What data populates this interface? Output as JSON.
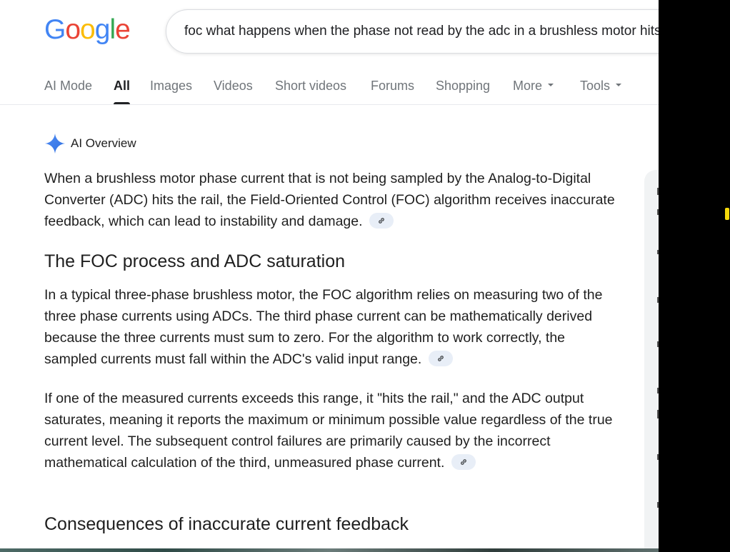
{
  "logo": {
    "text": "Google",
    "letters": [
      {
        "ch": "G",
        "color": "#4285F4"
      },
      {
        "ch": "o",
        "color": "#EA4335"
      },
      {
        "ch": "o",
        "color": "#FBBC05"
      },
      {
        "ch": "g",
        "color": "#4285F4"
      },
      {
        "ch": "l",
        "color": "#34A853"
      },
      {
        "ch": "e",
        "color": "#EA4335"
      }
    ]
  },
  "search": {
    "value": "foc what happens when the phase not read by the adc in a brushless motor hits the rail"
  },
  "tabs": [
    {
      "label": "AI Mode",
      "active": false,
      "dropdown": false
    },
    {
      "label": "All",
      "active": true,
      "dropdown": false
    },
    {
      "label": "Images",
      "active": false,
      "dropdown": false
    },
    {
      "label": "Videos",
      "active": false,
      "dropdown": false
    },
    {
      "label": "Short videos",
      "active": false,
      "dropdown": false
    },
    {
      "label": "Forums",
      "active": false,
      "dropdown": false
    },
    {
      "label": "Shopping",
      "active": false,
      "dropdown": false
    },
    {
      "label": "More",
      "active": false,
      "dropdown": true
    },
    {
      "label": "Tools",
      "active": false,
      "dropdown": true
    }
  ],
  "ai_overview": {
    "title": "AI Overview",
    "icon": "sparkle-icon",
    "intro": "When a brushless motor phase current that is not being sampled by the Analog-to-Digital Converter (ADC) hits the rail, the Field-Oriented Control (FOC) algorithm receives inaccurate feedback, which can lead to instability and damage.",
    "section1_heading": "The FOC process and ADC saturation",
    "section1_p1": "In a typical three-phase brushless motor, the FOC algorithm relies on measuring two of the three phase currents using ADCs. The third phase current can be mathematically derived because the three currents must sum to zero. For the algorithm to work correctly, the sampled currents must fall within the ADC's valid input range.",
    "section1_p2": "If one of the measured currents exceeds this range, it \"hits the rail,\" and the ADC output saturates, meaning it reports the maximum or minimum possible value regardless of the true current level. The subsequent control failures are primarily caused by the incorrect mathematical calculation of the third, unmeasured phase current.",
    "section2_heading": "Consequences of inaccurate current feedback"
  },
  "colors": {
    "accent_blue": "#4285F4",
    "text": "#1f1f1f",
    "muted": "#70757a",
    "chip_bg": "#e8eef7"
  }
}
